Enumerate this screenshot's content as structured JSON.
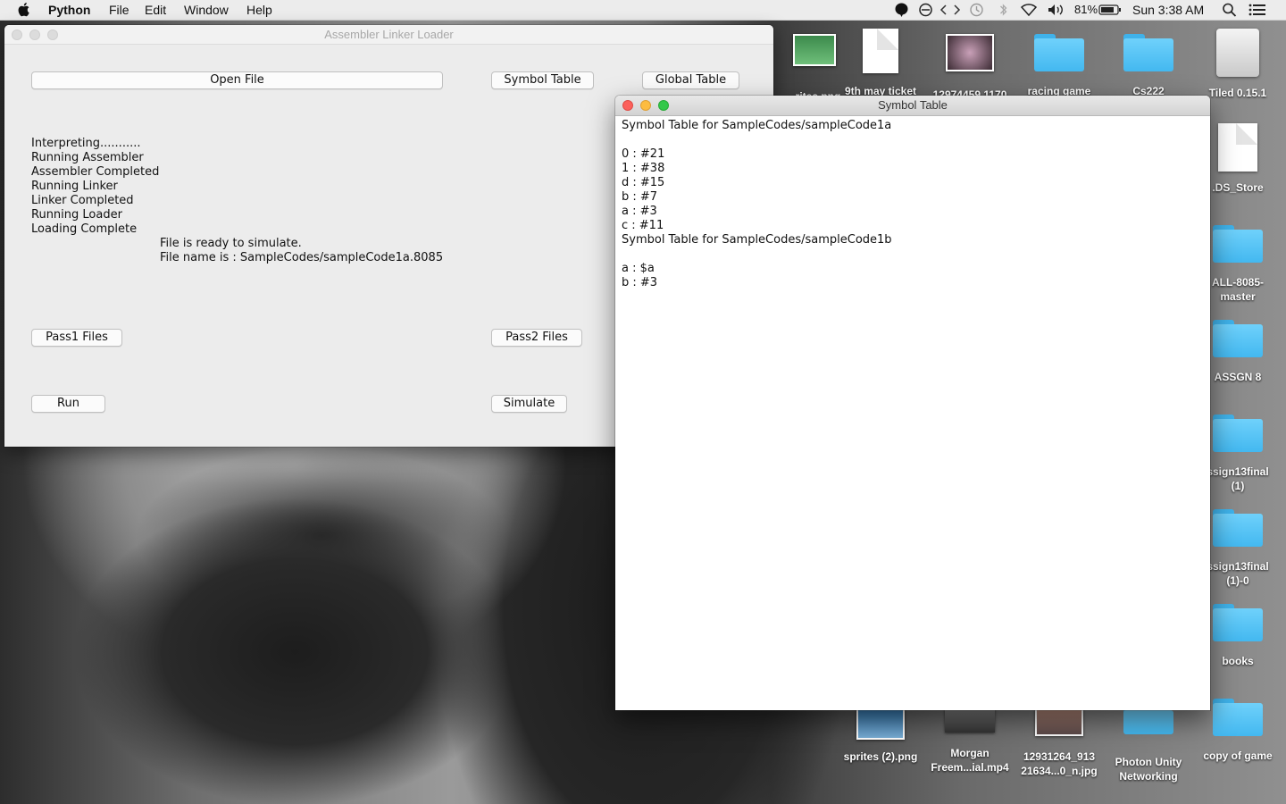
{
  "menubar": {
    "app_name": "Python",
    "menus": [
      "File",
      "Edit",
      "Window",
      "Help"
    ],
    "battery": "81%",
    "clock": "Sun 3:38 AM"
  },
  "desktop": {
    "icons_top": [
      {
        "label": "rites.png"
      },
      {
        "label": "9th may ticket"
      },
      {
        "label": "12974459 1170"
      },
      {
        "label": "racing game"
      },
      {
        "label": "Cs222"
      },
      {
        "label": "Tiled 0.15.1"
      }
    ],
    "icons_right": [
      {
        "label": ".DS_Store"
      },
      {
        "label": "ALL-8085-\nmaster"
      },
      {
        "label": "ASSGN 8"
      },
      {
        "label": "ssign13final\n(1)"
      },
      {
        "label": "ssign13final\n(1)-0"
      },
      {
        "label": "books"
      },
      {
        "label": "copy of game"
      }
    ],
    "icons_bottom": [
      {
        "label": "sprites (2).png"
      },
      {
        "label": "Morgan\nFreem...ial.mp4"
      },
      {
        "label": "12931264_913\n21634...0_n.jpg"
      },
      {
        "label": "Photon Unity\nNetworking"
      }
    ]
  },
  "main_window": {
    "title": "Assembler Linker Loader",
    "buttons": {
      "open_file": "Open File",
      "symbol_table": "Symbol Table",
      "global_table": "Global Table",
      "pass1": "Pass1 Files",
      "pass2": "Pass2 Files",
      "run": "Run",
      "simulate": "Simulate"
    },
    "log": [
      "Interpreting...........",
      "Running Assembler",
      "Assembler Completed",
      "Running Linker",
      "Linker Completed",
      "Running Loader",
      "Loading Complete"
    ],
    "ready_message": "File is ready to simulate.",
    "file_name_message": "File name is : SampleCodes/sampleCode1a.8085"
  },
  "symbol_window": {
    "title": "Symbol Table",
    "text": "Symbol Table for SampleCodes/sampleCode1a\n\n0 : #21\n1 : #38\nd : #15\nb : #7\na : #3\nc : #11\nSymbol Table for SampleCodes/sampleCode1b\n\na : $a\nb : #3"
  },
  "colors": {
    "folder_blue": "#4fc1f5",
    "close_red": "#fc605b",
    "minimize_yellow": "#fdbc40",
    "zoom_green": "#34c84a"
  }
}
